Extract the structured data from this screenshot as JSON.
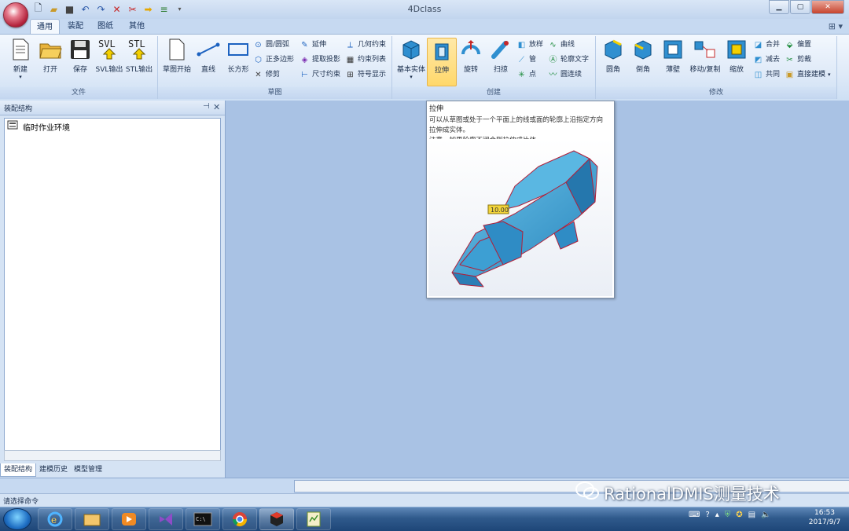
{
  "window": {
    "title": "4Dclass",
    "app_icon": "app-logo-icon"
  },
  "quick_access": [
    "new-icon",
    "open-icon",
    "save-icon",
    "undo-icon",
    "redo-icon",
    "delete-icon",
    "cut-icon",
    "next-icon",
    "settings-icon"
  ],
  "tabs": [
    {
      "label": "通用",
      "active": true
    },
    {
      "label": "装配",
      "active": false
    },
    {
      "label": "图纸",
      "active": false
    },
    {
      "label": "其他",
      "active": false
    }
  ],
  "ribbon": {
    "file": {
      "label": "文件",
      "items": [
        {
          "label": "新建",
          "icon": "new-doc-icon"
        },
        {
          "label": "打开",
          "icon": "folder-icon"
        },
        {
          "label": "保存",
          "icon": "save-disk-icon"
        },
        {
          "label": "SVL输出",
          "icon": "svl-export-icon"
        },
        {
          "label": "STL输出",
          "icon": "stl-export-icon"
        }
      ]
    },
    "sketch": {
      "label": "草图",
      "big": [
        {
          "label": "草图开始"
        },
        {
          "label": "直线"
        },
        {
          "label": "长方形"
        }
      ],
      "small": [
        [
          "圆/圆弧",
          "正多边形",
          "修剪"
        ],
        [
          "延伸",
          "提取投影",
          "尺寸约束"
        ],
        [
          "几何约束",
          "约束列表",
          "符号显示"
        ]
      ]
    },
    "create": {
      "label": "创建",
      "big": [
        {
          "label": "基本实体"
        },
        {
          "label": "拉伸",
          "active": true
        },
        {
          "label": "旋转"
        },
        {
          "label": "扫掠"
        }
      ],
      "small": [
        [
          "放样",
          "管",
          "点"
        ],
        [
          "曲线",
          "轮廓文字",
          "圆连续"
        ]
      ]
    },
    "modify": {
      "label": "修改",
      "big": [
        {
          "label": "圆角"
        },
        {
          "label": "倒角"
        },
        {
          "label": "薄壁"
        },
        {
          "label": "移动/复制"
        },
        {
          "label": "缩放"
        }
      ],
      "small": [
        [
          "合并",
          "减去",
          "共同"
        ],
        [
          "偏置",
          "剪裁",
          "直接建模"
        ]
      ]
    }
  },
  "panel": {
    "title": "装配结构",
    "tree_item": "临时作业环境",
    "tabs": [
      {
        "label": "装配结构",
        "active": true
      },
      {
        "label": "建模历史",
        "active": false
      },
      {
        "label": "模型管理",
        "active": false
      }
    ]
  },
  "tooltip": {
    "title": "拉伸",
    "lines": [
      "可以从草图或处于一个平面上的线或面的轮廓上沿指定方向",
      "拉伸成实体。",
      "注意，如果轮廓不闭合则拉伸成片体。"
    ],
    "dimension": "10.00"
  },
  "status": {
    "text": "请选择命令"
  },
  "watermark": "RationalDMIS测量技术",
  "clock": {
    "time": "16:53",
    "date": "2017/9/7"
  },
  "colors": {
    "ribbon_bg": "#dfeaf8",
    "work_bg": "#a9c2e4",
    "model_blue": "#3fa6d6",
    "active_button": "#ffd86b"
  }
}
